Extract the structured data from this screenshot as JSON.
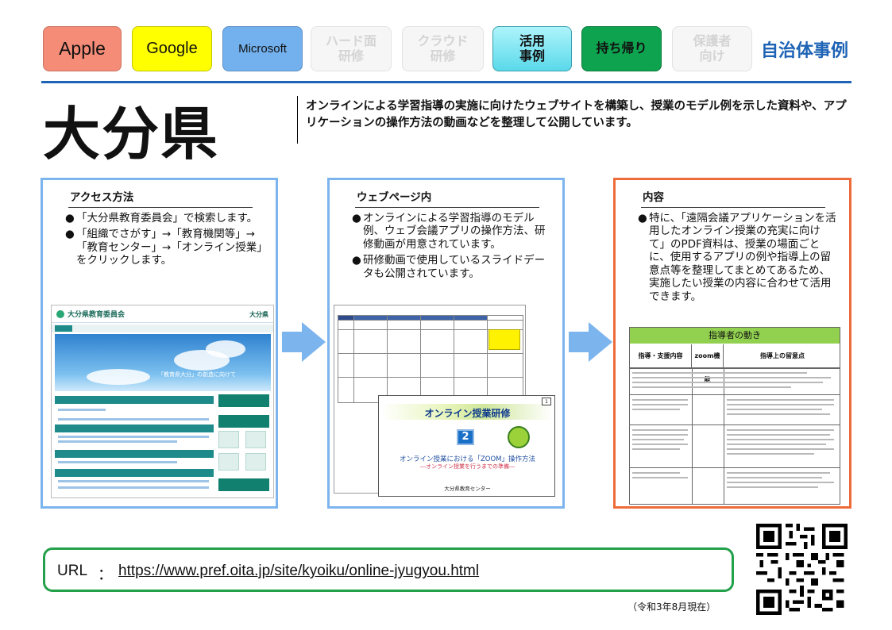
{
  "tabs": {
    "apple": "Apple",
    "google": "Google",
    "microsoft": "Microsoft",
    "hard_line1": "ハード面",
    "hard_line2": "研修",
    "cloud_line1": "クラウド",
    "cloud_line2": "研修",
    "katsuyo_line1": "活用",
    "katsuyo_line2": "事例",
    "mochikaeri": "持ち帰り",
    "hogosha_line1": "保護者",
    "hogosha_line2": "向け",
    "jichitai": "自治体事例"
  },
  "title": "大分県",
  "description": "オンラインによる学習指導の実施に向けたウェブサイトを構築し、授業のモデル例を示した資料や、アプリケーションの操作方法の動画などを整理して公開しています。",
  "panels": {
    "access": {
      "heading": "アクセス方法",
      "bullets": [
        "「大分県教育委員会」で検索します。",
        "「組織でさがす」→「教育機関等」→「教育センター」→「オンライン授業」をクリックします。"
      ]
    },
    "web": {
      "heading": "ウェブページ内",
      "bullets": [
        "オンラインによる学習指導のモデル例、ウェブ会議アプリの操作方法、研修動画が用意されています。",
        "研修動画で使用しているスライドデータも公開されています。"
      ]
    },
    "content": {
      "heading": "内容",
      "bullets": [
        "特に、「遠隔会議アプリケーションを活用したオンライン授業の充実に向けて」のPDF資料は、授業の場面ごとに、使用するアプリの例や指導上の留意点等を整理してまとめてあるため、実施したい授業の内容に合わせて活用できます。"
      ]
    }
  },
  "site_thumb": {
    "org_name": "大分県教育委員会",
    "site_right": "大分県",
    "sky_caption": "「教育県大分」の創造に向けて"
  },
  "slide": {
    "title": "オンライン授業研修",
    "number": "2",
    "subtitle": "オンライン授業における「ZOOM」操作方法",
    "subtitle2": "―オンライン授業を行うまでの準備―",
    "org": "大分県教育センター",
    "page": "1"
  },
  "table_thumb": {
    "title": "指導者の動き",
    "col1": "指導・支援内容",
    "col2": "zoom機能",
    "col3": "指導上の留意点"
  },
  "url": {
    "label": "URL",
    "colon": "：",
    "link": "https://www.pref.oita.jp/site/kyoiku/online-jyugyou.html"
  },
  "as_of": "（令和3年8月現在）",
  "bullet_symbol": "●",
  "colors": {
    "apple": "#f48c78",
    "google": "#ffff00",
    "microsoft": "#73b1ee",
    "katsuyo": "#5ad9ea",
    "mochikaeri": "#0ea34f",
    "accent_blue": "#1e63b5",
    "panel_blue": "#7cb4ee",
    "panel_orange": "#ee6b3a",
    "url_green": "#22a04a"
  }
}
